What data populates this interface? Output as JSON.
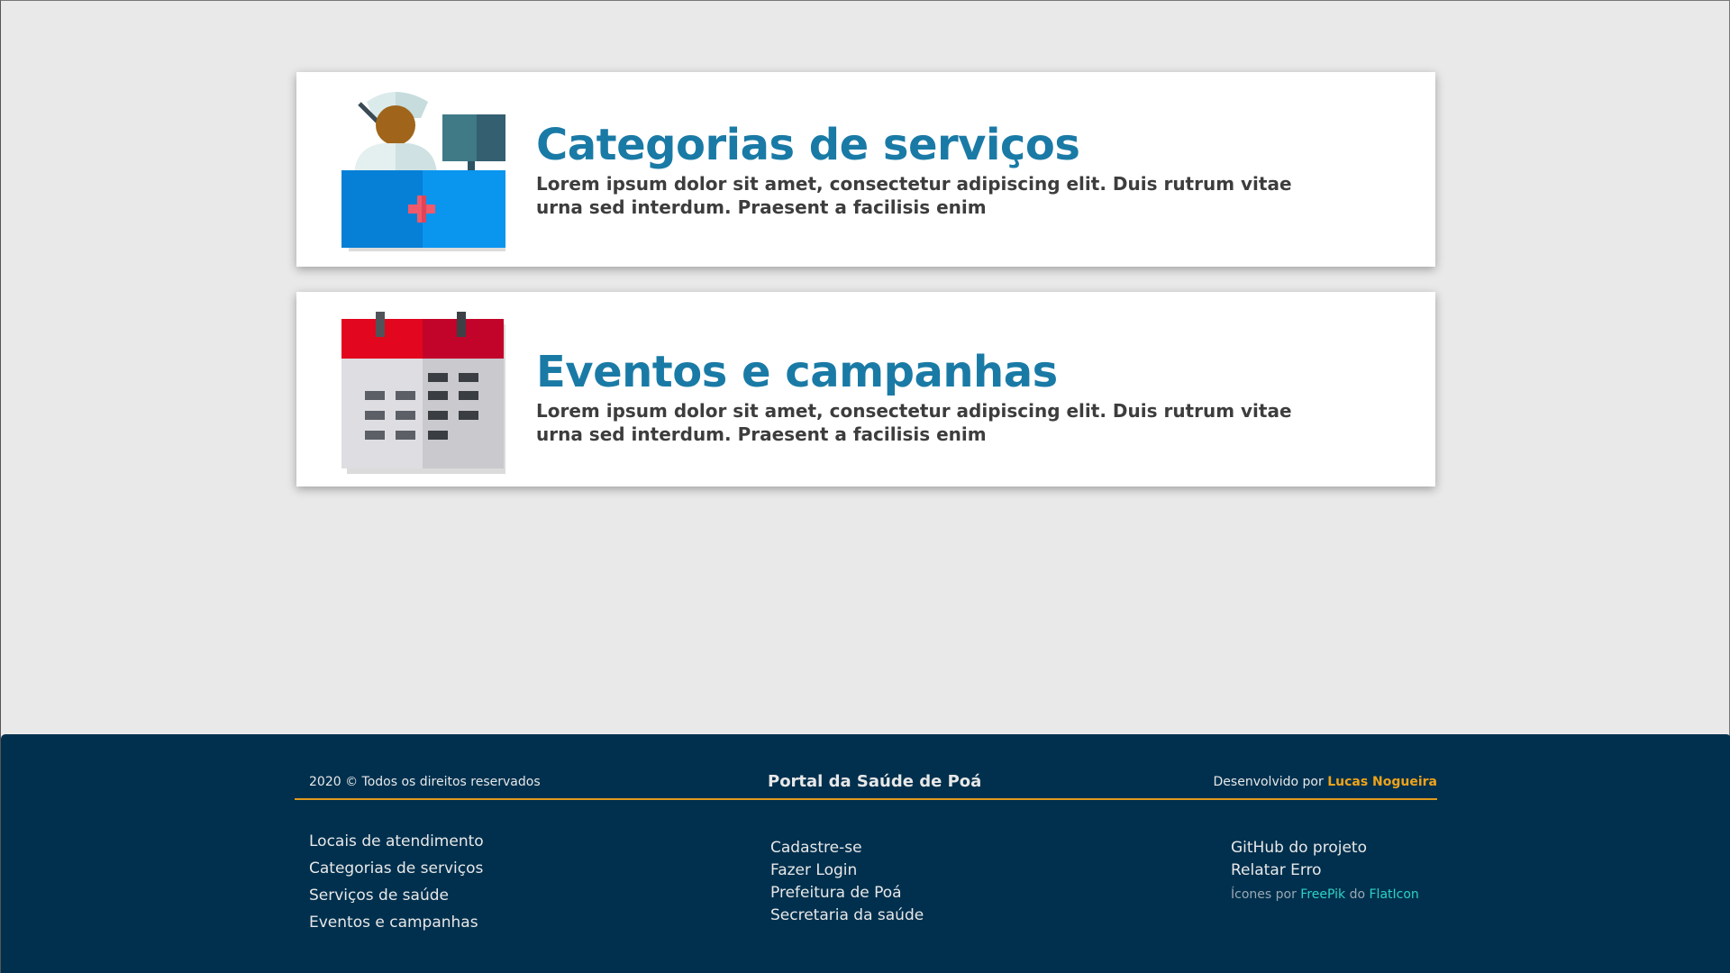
{
  "cards": [
    {
      "title": "Categorias de serviços",
      "description": "Lorem ipsum dolor sit amet, consectetur adipiscing elit. Duis rutrum vitae urna sed interdum. Praesent a facilisis enim",
      "icon": "nurse-reception-icon"
    },
    {
      "title": "Eventos e campanhas",
      "description": "Lorem ipsum dolor sit amet, consectetur adipiscing elit. Duis rutrum vitae urna sed interdum. Praesent a facilisis enim",
      "icon": "calendar-icon"
    }
  ],
  "footer": {
    "copyright": "2020 © Todos os direitos reservados",
    "portal_title": "Portal da Saúde de Poá",
    "developed_by": "Desenvolvido por",
    "author": "Lucas Nogueira",
    "col1": [
      "Locais de atendimento",
      "Categorias de serviços",
      "Serviços de saúde",
      "Eventos e campanhas"
    ],
    "col2": [
      "Cadastre-se",
      "Fazer Login",
      "Prefeitura de Poá",
      "Secretaria da saúde"
    ],
    "col3": [
      "GitHub do projeto",
      "Relatar Erro"
    ],
    "credits": {
      "prefix": "Ícones por",
      "freepik": "FreePik",
      "middle": "do",
      "flaticon": "FlatIcon"
    }
  },
  "colors": {
    "background": "#e9e9e9",
    "card_title": "#1a7aa6",
    "footer_bg": "#00304e",
    "accent": "#e09a1e",
    "link_teal": "#2fd2c4"
  }
}
